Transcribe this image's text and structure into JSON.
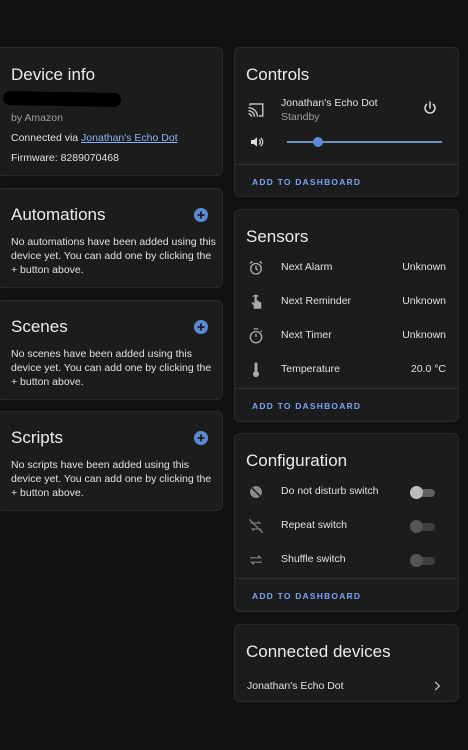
{
  "colors": {
    "background": "#111111",
    "card": "#1c1c1c",
    "accent": "#5c88d8",
    "link": "#8ab4f8"
  },
  "device_info": {
    "title": "Device info",
    "manufacturer": "by Amazon",
    "connected_prefix": "Connected via ",
    "connected_link": "Jonathan's Echo Dot",
    "firmware": "Firmware: 8289070468"
  },
  "automations": {
    "title": "Automations",
    "text": "No automations have been added using this device yet. You can add one by clicking the + button above."
  },
  "scenes": {
    "title": "Scenes",
    "text": "No scenes have been added using this device yet. You can add one by clicking the + button above."
  },
  "scripts": {
    "title": "Scripts",
    "text": "No scripts have been added using this device yet. You can add one by clicking the + button above."
  },
  "controls": {
    "title": "Controls",
    "media_name": "Jonathan's Echo Dot",
    "media_state": "Standby",
    "volume_level": 0.2,
    "add_to_dashboard": "ADD TO DASHBOARD"
  },
  "sensors": {
    "title": "Sensors",
    "items": [
      {
        "icon": "alarm-clock-icon",
        "label": "Next Alarm",
        "value": "Unknown"
      },
      {
        "icon": "hand-pointer-icon",
        "label": "Next Reminder",
        "value": "Unknown"
      },
      {
        "icon": "timer-icon",
        "label": "Next Timer",
        "value": "Unknown"
      },
      {
        "icon": "thermometer-icon",
        "label": "Temperature",
        "value": "20.0 °C"
      }
    ],
    "add_to_dashboard": "ADD TO DASHBOARD"
  },
  "configuration": {
    "title": "Configuration",
    "items": [
      {
        "icon": "do-not-disturb-icon",
        "label": "Do not disturb switch",
        "on": false
      },
      {
        "icon": "repeat-off-icon",
        "label": "Repeat switch",
        "on": false
      },
      {
        "icon": "shuffle-disabled-icon",
        "label": "Shuffle switch",
        "on": false
      }
    ],
    "add_to_dashboard": "ADD TO DASHBOARD"
  },
  "connected_devices": {
    "title": "Connected devices",
    "items": [
      {
        "label": "Jonathan's Echo Dot"
      }
    ]
  }
}
